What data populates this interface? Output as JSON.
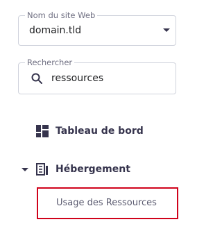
{
  "site_selector": {
    "label": "Nom du site Web",
    "value": "domain.tld"
  },
  "search": {
    "label": "Rechercher",
    "value": "ressources"
  },
  "nav": {
    "dashboard": "Tableau de bord",
    "hosting": "Hébergement",
    "resource_usage": "Usage des Ressources"
  },
  "icons": {
    "dropdown": "chevron-down-icon",
    "search": "search-icon",
    "dashboard": "dashboard-grid-icon",
    "hosting": "server-icon",
    "expand": "caret-down-icon"
  },
  "colors": {
    "highlight_border": "#d0021b",
    "nav_text": "#36344d"
  }
}
